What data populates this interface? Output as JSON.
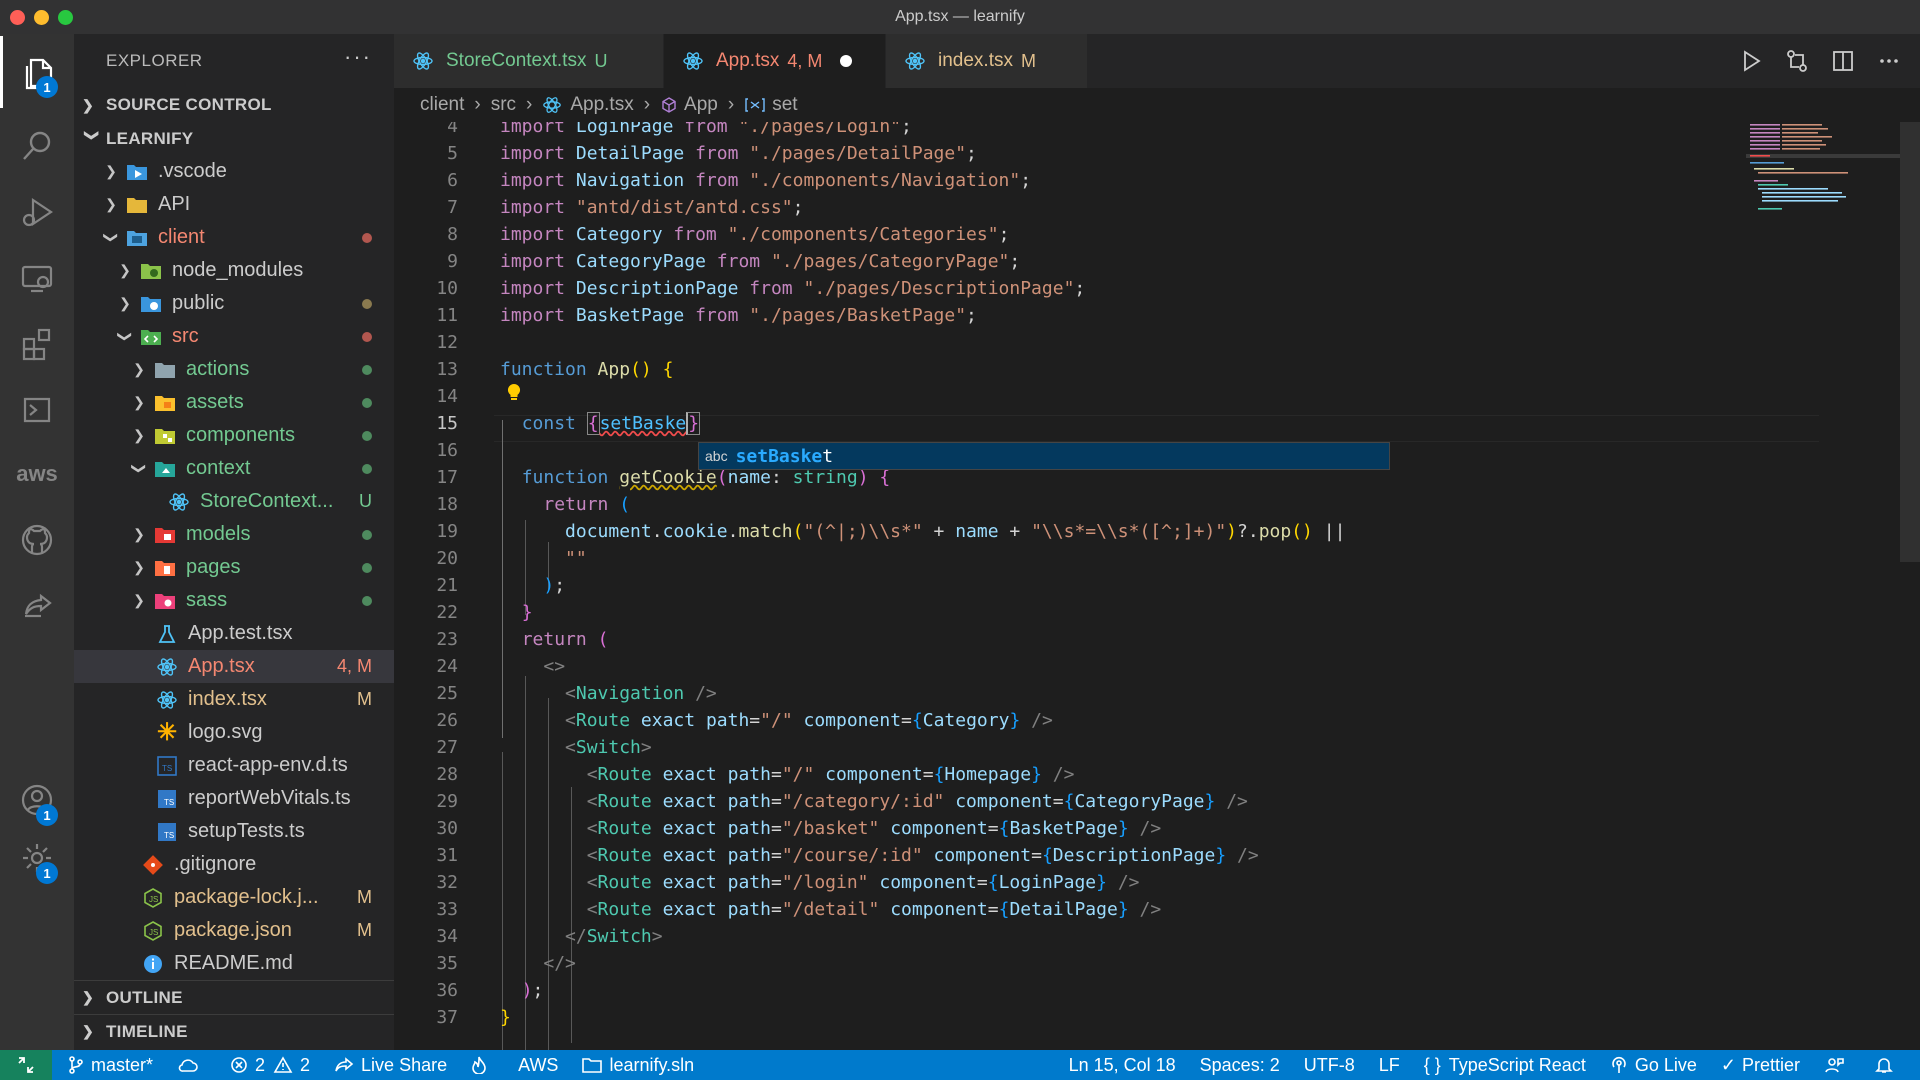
{
  "window": {
    "title": "App.tsx — learnify"
  },
  "activity": {
    "explorer_badge": "1",
    "accounts_badge": "1",
    "manage_badge": "1",
    "aws_label": "aws"
  },
  "sidebar": {
    "title": "EXPLORER",
    "more": "···",
    "source_control": "SOURCE CONTROL",
    "project": "LEARNIFY",
    "outline": "OUTLINE",
    "timeline": "TIMELINE",
    "tree": [
      {
        "name": ".vscode",
        "status": ""
      },
      {
        "name": "API",
        "status": ""
      },
      {
        "name": "client",
        "status": ""
      },
      {
        "name": "node_modules",
        "status": ""
      },
      {
        "name": "public",
        "status": ""
      },
      {
        "name": "src",
        "status": ""
      },
      {
        "name": "actions",
        "status": ""
      },
      {
        "name": "assets",
        "status": ""
      },
      {
        "name": "components",
        "status": ""
      },
      {
        "name": "context",
        "status": ""
      },
      {
        "name": "StoreContext...",
        "status": "U"
      },
      {
        "name": "models",
        "status": ""
      },
      {
        "name": "pages",
        "status": ""
      },
      {
        "name": "sass",
        "status": ""
      },
      {
        "name": "App.test.tsx",
        "status": ""
      },
      {
        "name": "App.tsx",
        "status": "4, M"
      },
      {
        "name": "index.tsx",
        "status": "M"
      },
      {
        "name": "logo.svg",
        "status": ""
      },
      {
        "name": "react-app-env.d.ts",
        "status": ""
      },
      {
        "name": "reportWebVitals.ts",
        "status": ""
      },
      {
        "name": "setupTests.ts",
        "status": ""
      },
      {
        "name": ".gitignore",
        "status": ""
      },
      {
        "name": "package-lock.j...",
        "status": "M"
      },
      {
        "name": "package.json",
        "status": "M"
      },
      {
        "name": "README.md",
        "status": ""
      }
    ]
  },
  "tabs": [
    {
      "label": "StoreContext.tsx",
      "status": "U"
    },
    {
      "label": "App.tsx",
      "status": "4, M"
    },
    {
      "label": "index.tsx",
      "status": "M"
    }
  ],
  "breadcrumb": [
    "client",
    "src",
    "App.tsx",
    "App",
    "set"
  ],
  "editor": {
    "line_numbers": [
      "4",
      "5",
      "6",
      "7",
      "8",
      "9",
      "10",
      "11",
      "12",
      "13",
      "14",
      "15",
      "16",
      "17",
      "18",
      "19",
      "20",
      "21",
      "22",
      "23",
      "24",
      "25",
      "26",
      "27",
      "28",
      "29",
      "30",
      "31",
      "32",
      "33",
      "34",
      "35",
      "36",
      "37"
    ],
    "suggestion": {
      "kind": "abc",
      "match": "setBaske",
      "rest": "t"
    }
  },
  "status": {
    "branch": "master*",
    "errors": "2",
    "warnings": "2",
    "live_share": "Live Share",
    "aws": "AWS",
    "solution": "learnify.sln",
    "position": "Ln 15, Col 18",
    "spaces": "Spaces: 2",
    "encoding": "UTF-8",
    "eol": "LF",
    "language": "TypeScript React",
    "go_live": "Go Live",
    "prettier": "Prettier"
  },
  "colors": {
    "accent": "#007acc",
    "modified": "#e2c08d",
    "untracked": "#73c991",
    "error": "#f14c4c"
  }
}
